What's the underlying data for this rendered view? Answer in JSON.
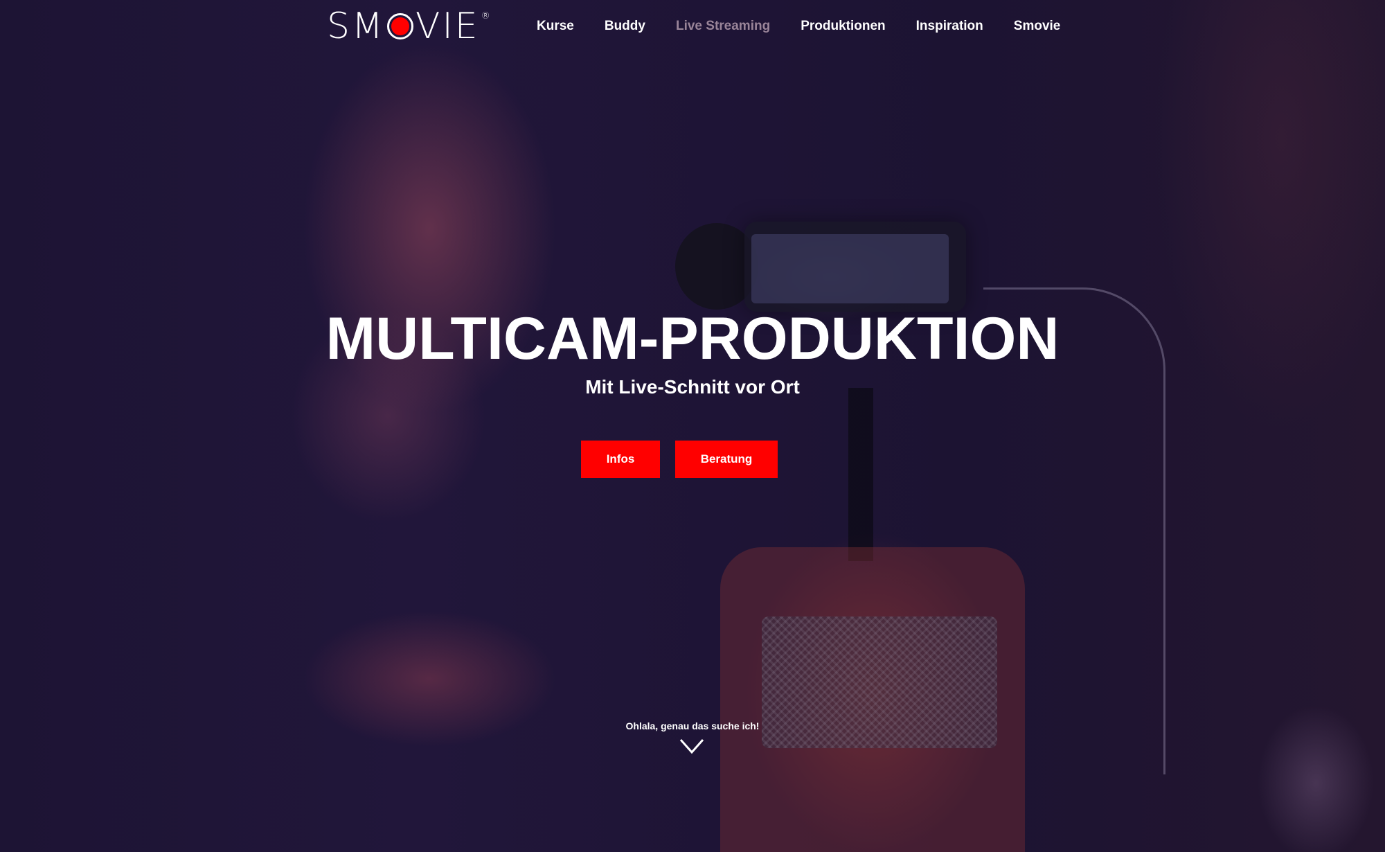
{
  "brand": {
    "name_left": "SM",
    "name_right": "VIE",
    "registered": "®",
    "accent_color": "#ff0000"
  },
  "nav": {
    "items": [
      {
        "label": "Kurse",
        "active": false
      },
      {
        "label": "Buddy",
        "active": false
      },
      {
        "label": "Live Streaming",
        "active": true
      },
      {
        "label": "Produktionen",
        "active": false
      },
      {
        "label": "Inspiration",
        "active": false
      },
      {
        "label": "Smovie",
        "active": false
      }
    ]
  },
  "hero": {
    "title": "MULTICAM-PRODUKTION",
    "subtitle": "Mit Live-Schnitt vor Ort",
    "buttons": {
      "infos": "Infos",
      "beratung": "Beratung"
    },
    "scroll_hint": "Ohlala, genau das suche ich!",
    "scroll_icon": "chevron-down-icon"
  }
}
